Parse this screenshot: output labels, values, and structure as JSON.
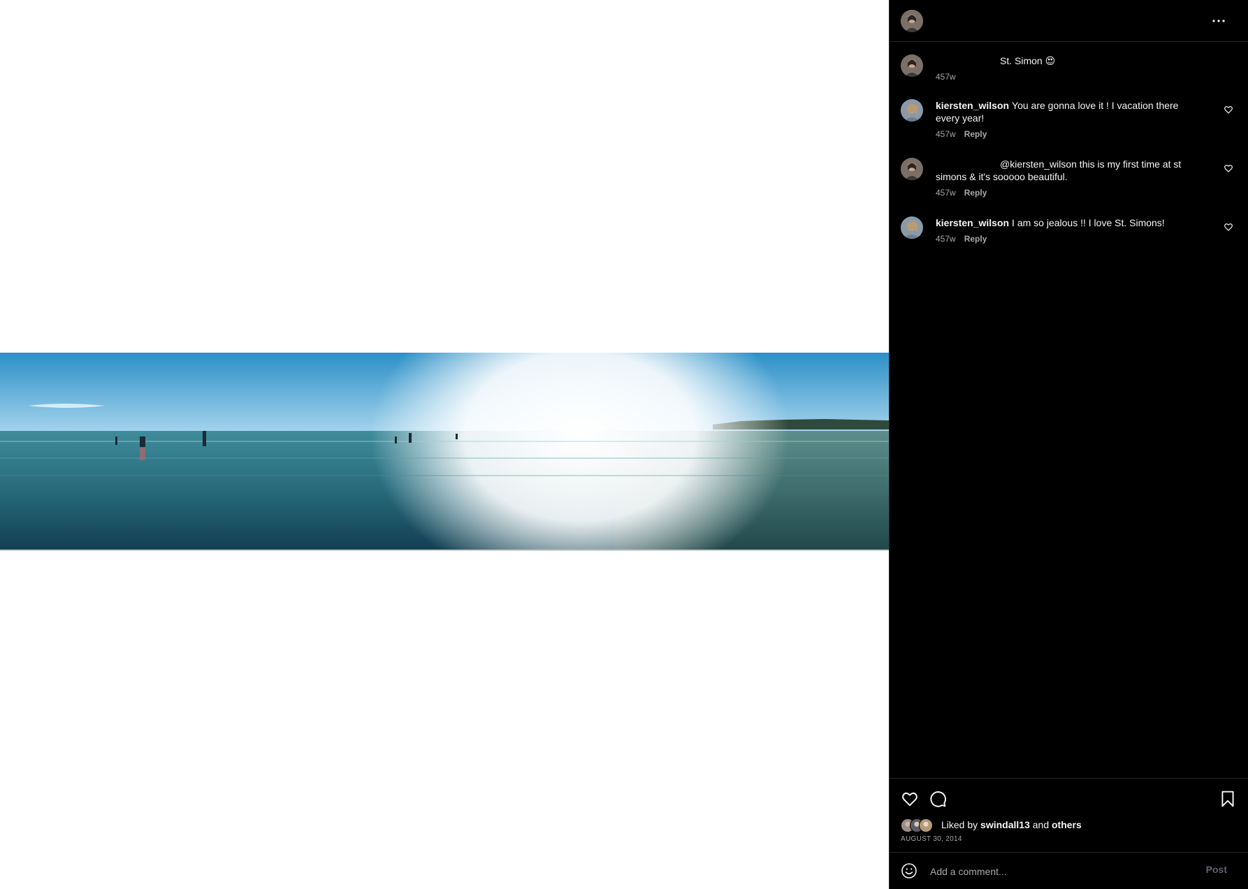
{
  "post": {
    "date": "AUGUST 30, 2014",
    "image_alt": "Panoramic beach photo"
  },
  "header": {
    "more_icon": "more-horizontal-icon"
  },
  "caption": {
    "text": "St. Simon 😍",
    "time": "457w"
  },
  "comments": [
    {
      "username": "kiersten_wilson",
      "text": "You are gonna love it ! I vacation there every year!",
      "time": "457w",
      "reply": "Reply"
    },
    {
      "username": "",
      "text": "@kiersten_wilson this is my first time at st simons & it's sooooo beautiful.",
      "time": "457w",
      "reply": "Reply"
    },
    {
      "username": "kiersten_wilson",
      "text": "I am so jealous !! I love St. Simons!",
      "time": "457w",
      "reply": "Reply"
    }
  ],
  "likes": {
    "prefix": "Liked by",
    "user": "swindall13",
    "joiner": "and",
    "others": "others"
  },
  "add_comment": {
    "placeholder": "Add a comment...",
    "post_label": "Post"
  },
  "colors": {
    "panel_bg": "#000000",
    "text": "#f5f5f5",
    "muted": "#a8a8a8",
    "divider": "#262626",
    "post_disabled": "#5a6472"
  }
}
